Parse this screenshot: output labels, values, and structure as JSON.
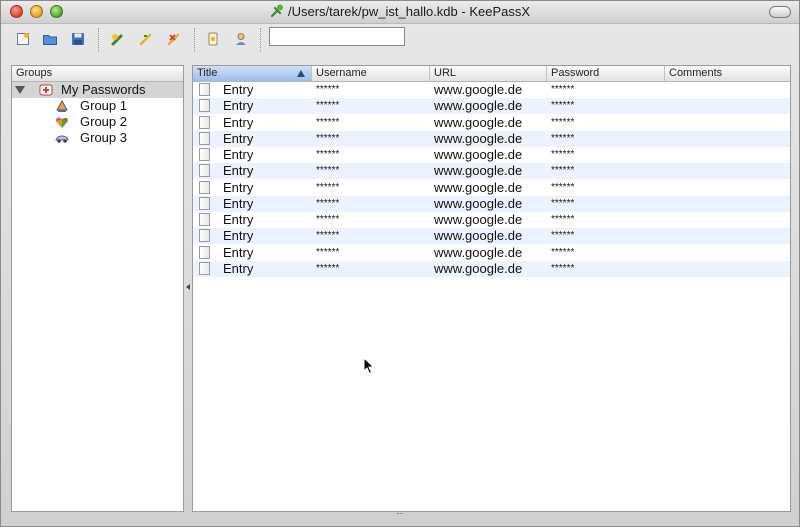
{
  "window": {
    "title": "/Users/tarek/pw_ist_hallo.kdb - KeePassX"
  },
  "toolbar": {
    "buttons": [
      {
        "name": "new-database-icon"
      },
      {
        "name": "open-database-icon"
      },
      {
        "name": "save-database-icon"
      },
      {
        "name": "add-entry-icon"
      },
      {
        "name": "edit-entry-icon"
      },
      {
        "name": "delete-entry-icon"
      },
      {
        "name": "copy-password-icon"
      },
      {
        "name": "copy-username-icon"
      }
    ],
    "search": {
      "value": "",
      "placeholder": ""
    }
  },
  "groups": {
    "header": "Groups",
    "root": {
      "label": "My Passwords",
      "icon": "keepass-root-icon",
      "expanded": true,
      "selected": true
    },
    "children": [
      {
        "label": "Group 1",
        "icon": "group-computer-icon"
      },
      {
        "label": "Group 2",
        "icon": "group-puzzle-icon"
      },
      {
        "label": "Group 3",
        "icon": "group-car-icon"
      }
    ]
  },
  "entries": {
    "columns": [
      "Title",
      "Username",
      "URL",
      "Password",
      "Comments"
    ],
    "sorted_column": "Title",
    "rows": [
      {
        "title": "Entry",
        "username": "******",
        "url": "www.google.de",
        "password": "******",
        "comments": ""
      },
      {
        "title": "Entry",
        "username": "******",
        "url": "www.google.de",
        "password": "******",
        "comments": ""
      },
      {
        "title": "Entry",
        "username": "******",
        "url": "www.google.de",
        "password": "******",
        "comments": ""
      },
      {
        "title": "Entry",
        "username": "******",
        "url": "www.google.de",
        "password": "******",
        "comments": ""
      },
      {
        "title": "Entry",
        "username": "******",
        "url": "www.google.de",
        "password": "******",
        "comments": ""
      },
      {
        "title": "Entry",
        "username": "******",
        "url": "www.google.de",
        "password": "******",
        "comments": ""
      },
      {
        "title": "Entry",
        "username": "******",
        "url": "www.google.de",
        "password": "******",
        "comments": ""
      },
      {
        "title": "Entry",
        "username": "******",
        "url": "www.google.de",
        "password": "******",
        "comments": ""
      },
      {
        "title": "Entry",
        "username": "******",
        "url": "www.google.de",
        "password": "******",
        "comments": ""
      },
      {
        "title": "Entry",
        "username": "******",
        "url": "www.google.de",
        "password": "******",
        "comments": ""
      },
      {
        "title": "Entry",
        "username": "******",
        "url": "www.google.de",
        "password": "******",
        "comments": ""
      },
      {
        "title": "Entry",
        "username": "******",
        "url": "www.google.de",
        "password": "******",
        "comments": ""
      }
    ]
  },
  "colors": {
    "row_alt": "#edf3fe",
    "header_active": "#9dbde8",
    "group_selected": "#d4d4d4"
  }
}
